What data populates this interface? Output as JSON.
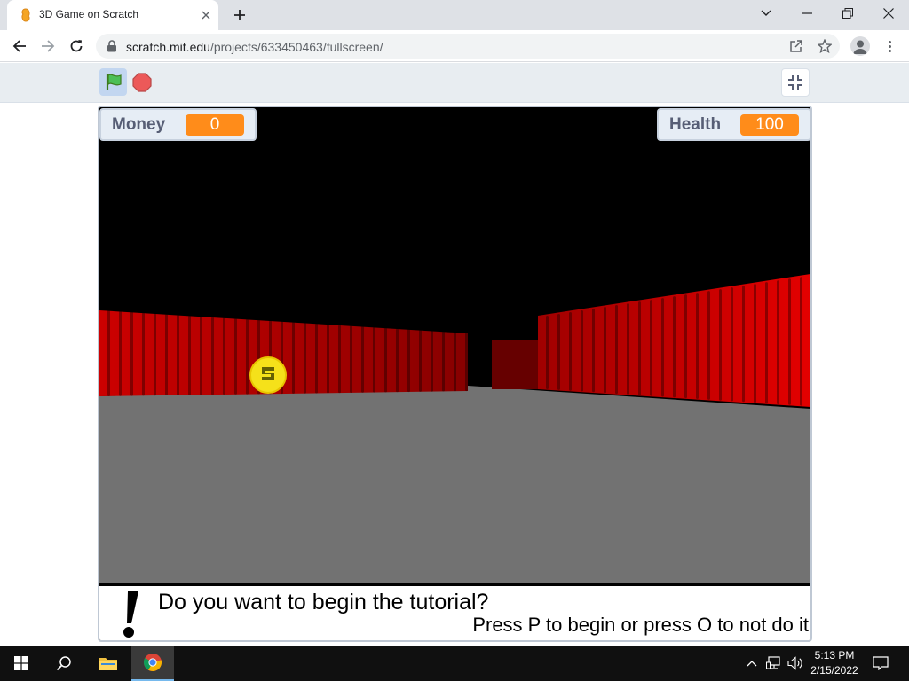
{
  "browser": {
    "tab": {
      "title": "3D Game on Scratch"
    },
    "new_tab_symbol": "+",
    "url": {
      "host": "scratch.mit.edu",
      "path": "/projects/633450463/fullscreen/"
    },
    "icons": [
      "scratch-favicon-icon",
      "close-icon",
      "plus-icon",
      "chevron-down-icon",
      "minimize-icon",
      "restore-icon",
      "window-close-icon",
      "back-arrow-icon",
      "forward-arrow-icon",
      "reload-icon",
      "lock-icon",
      "share-icon",
      "star-icon",
      "profile-icon",
      "more-vert-icon"
    ]
  },
  "scratch": {
    "controls": {
      "icons": [
        "green-flag-icon",
        "stop-sign-icon",
        "exit-fullscreen-icon"
      ]
    },
    "monitors": {
      "money": {
        "label": "Money",
        "value": "0"
      },
      "health": {
        "label": "Health",
        "value": "100"
      }
    },
    "dialog": {
      "question": "Do you want to begin the tutorial?",
      "hint": "Press P to begin or press O to not do it",
      "icon": "exclamation-icon"
    },
    "colors": {
      "monitor_value": "#ff8c1a",
      "wall": "#d40000",
      "floor": "#727272",
      "sky": "#000000",
      "coin": "#f5e11a"
    }
  },
  "taskbar": {
    "time": "5:13 PM",
    "date": "2/15/2022",
    "icons": [
      "windows-start-icon",
      "search-icon",
      "file-explorer-icon",
      "chrome-icon",
      "chevron-up-icon",
      "network-icon",
      "volume-icon",
      "notification-icon"
    ]
  }
}
